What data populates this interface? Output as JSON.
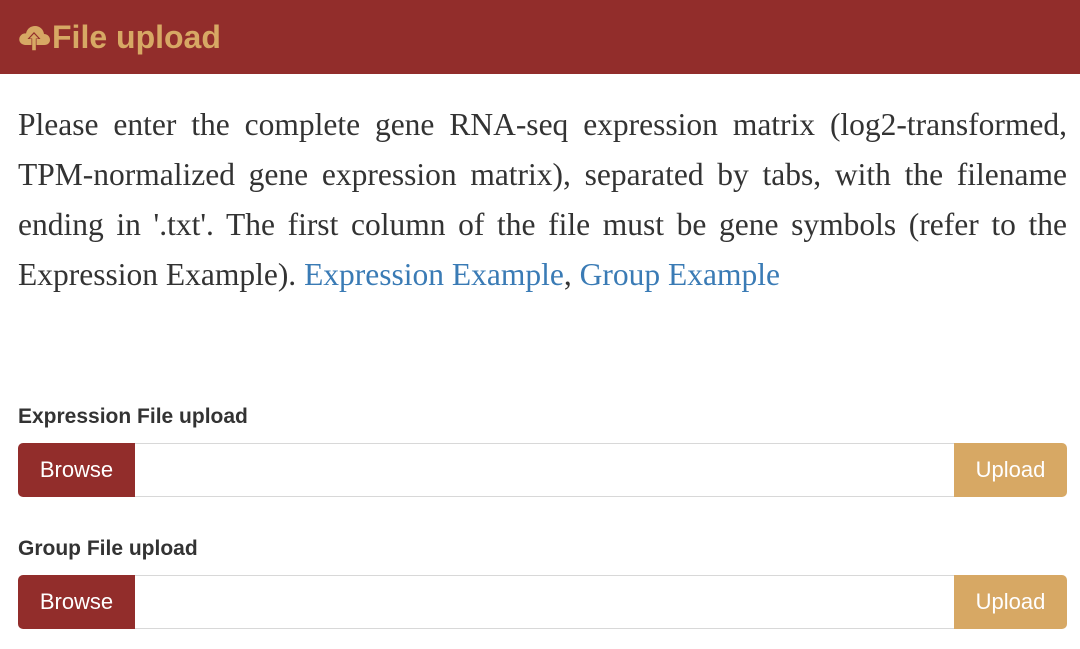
{
  "header": {
    "title": "File upload",
    "icon": "cloud-upload-icon",
    "background_color": "#922d2b",
    "title_color": "#d7a864"
  },
  "description": {
    "text": "Please enter the complete gene RNA-seq expression matrix (log2-transformed, TPM-normalized gene expression matrix), separated by tabs, with the filename ending in '.txt'. The first column of the file must be gene symbols (refer to the Expression Example).",
    "link_expression": "Expression Example",
    "separator": ",",
    "link_group": "Group Example",
    "link_color": "#3a7bb5"
  },
  "expression_upload": {
    "label": "Expression File upload",
    "browse_label": "Browse",
    "input_value": "",
    "upload_label": "Upload"
  },
  "group_upload": {
    "label": "Group File upload",
    "browse_label": "Browse",
    "input_value": "",
    "upload_label": "Upload"
  },
  "colors": {
    "primary": "#922d2b",
    "accent": "#d7a864"
  }
}
